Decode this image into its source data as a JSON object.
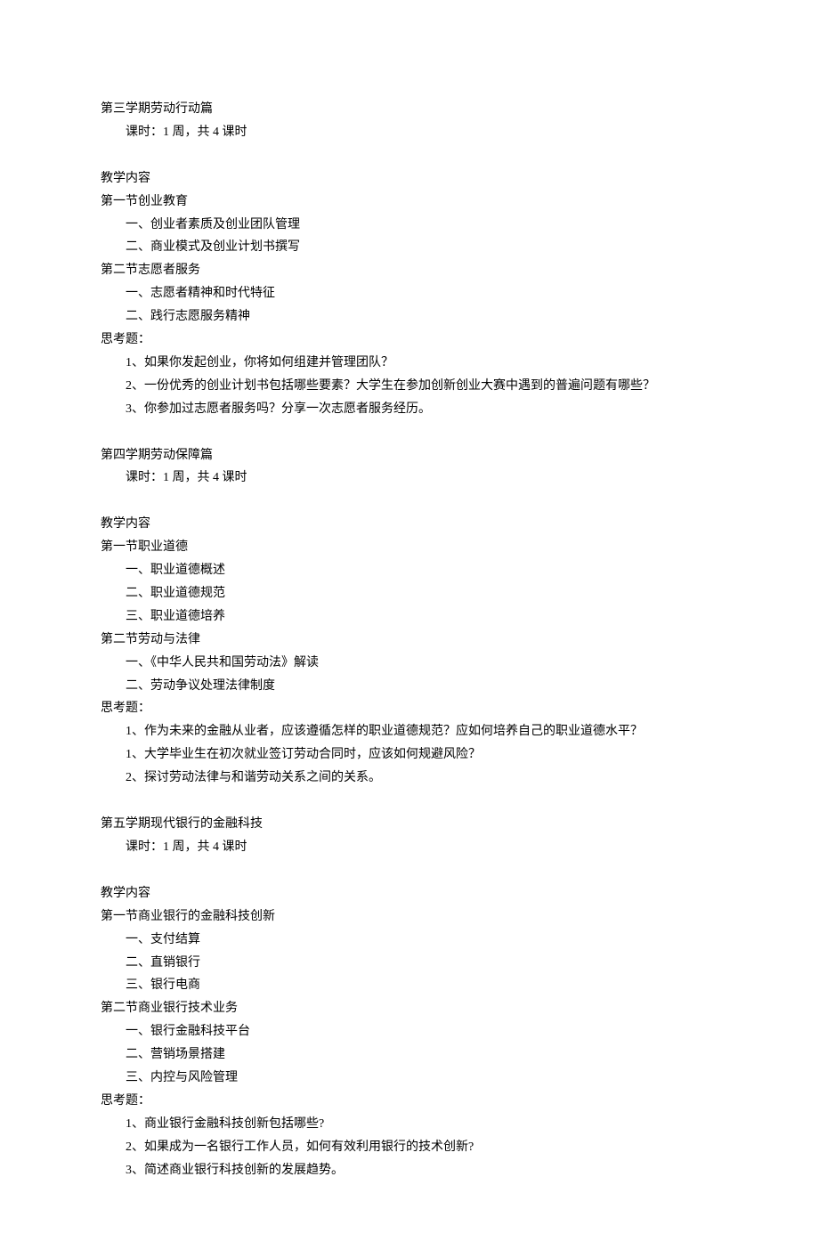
{
  "semester3": {
    "title": "第三学期劳动行动篇",
    "duration": "课时：1 周，共 4 课时",
    "contentHeader": "教学内容",
    "section1": {
      "title": "第一节创业教育",
      "item1": "一、创业者素质及创业团队管理",
      "item2": "二、商业模式及创业计划书撰写"
    },
    "section2": {
      "title": "第二节志愿者服务",
      "item1": "一、志愿者精神和时代特征",
      "item2": "二、践行志愿服务精神"
    },
    "questionsHeader": "思考题：",
    "q1": "1、如果你发起创业，你将如何组建并管理团队？",
    "q2": "2、一份优秀的创业计划书包括哪些要素？大学生在参加创新创业大赛中遇到的普遍问题有哪些？",
    "q3": "3、你参加过志愿者服务吗？分享一次志愿者服务经历。"
  },
  "semester4": {
    "title": "第四学期劳动保障篇",
    "duration": "课时：1 周，共 4 课时",
    "contentHeader": "教学内容",
    "section1": {
      "title": "第一节职业道德",
      "item1": "一、职业道德概述",
      "item2": "二、职业道德规范",
      "item3": "三、职业道德培养"
    },
    "section2": {
      "title": "第二节劳动与法律",
      "item1": "一、《中华人民共和国劳动法》解读",
      "item2": "二、劳动争议处理法律制度"
    },
    "questionsHeader": "思考题：",
    "q1": "1、作为未来的金融从业者，应该遵循怎样的职业道德规范？应如何培养自己的职业道德水平？",
    "q2": "1、大学毕业生在初次就业签订劳动合同时，应该如何规避风险？",
    "q3": "2、探讨劳动法律与和谐劳动关系之间的关系。"
  },
  "semester5": {
    "title": "第五学期现代银行的金融科技",
    "duration": "课时：1 周，共 4 课时",
    "contentHeader": "教学内容",
    "section1": {
      "title": "第一节商业银行的金融科技创新",
      "item1": "一、支付结算",
      "item2": "二、直销银行",
      "item3": "三、银行电商"
    },
    "section2": {
      "title": "第二节商业银行技术业务",
      "item1": "一、银行金融科技平台",
      "item2": "二、营销场景搭建",
      "item3": "三、内控与风险管理"
    },
    "questionsHeader": "思考题：",
    "q1": "1、商业银行金融科技创新包括哪些?",
    "q2": "2、如果成为一名银行工作人员，如何有效利用银行的技术创新?",
    "q3": "3、简述商业银行科技创新的发展趋势。"
  }
}
